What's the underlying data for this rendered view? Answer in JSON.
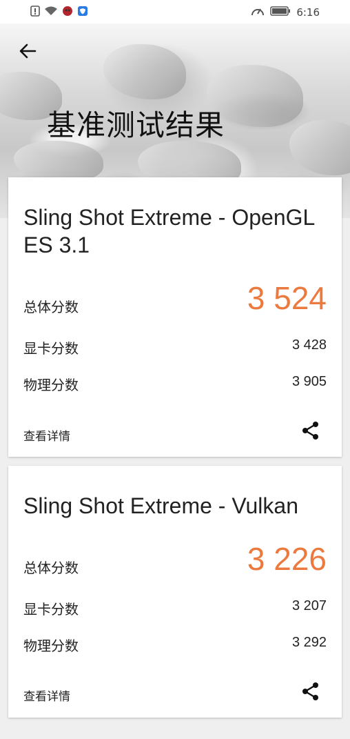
{
  "status_bar": {
    "time": "6:16",
    "icons": [
      "alert-icon",
      "wifi-icon",
      "app-icon",
      "shield-icon",
      "speed-icon",
      "battery-icon"
    ]
  },
  "header": {
    "title": "基准测试结果",
    "back_icon": "arrow-left-icon"
  },
  "colors": {
    "accent": "#ec7a3f",
    "text": "#222222",
    "card_bg": "#ffffff",
    "page_bg": "#efefef"
  },
  "results": [
    {
      "title": "Sling Shot Extreme - OpenGL ES 3.1",
      "overall_label": "总体分数",
      "overall_value": "3 524",
      "graphics_label": "显卡分数",
      "graphics_value": "3 428",
      "physics_label": "物理分数",
      "physics_value": "3 905",
      "details_label": "查看详情",
      "share_icon": "share-icon"
    },
    {
      "title": "Sling Shot Extreme - Vulkan",
      "overall_label": "总体分数",
      "overall_value": "3 226",
      "graphics_label": "显卡分数",
      "graphics_value": "3 207",
      "physics_label": "物理分数",
      "physics_value": "3 292",
      "details_label": "查看详情",
      "share_icon": "share-icon"
    }
  ]
}
